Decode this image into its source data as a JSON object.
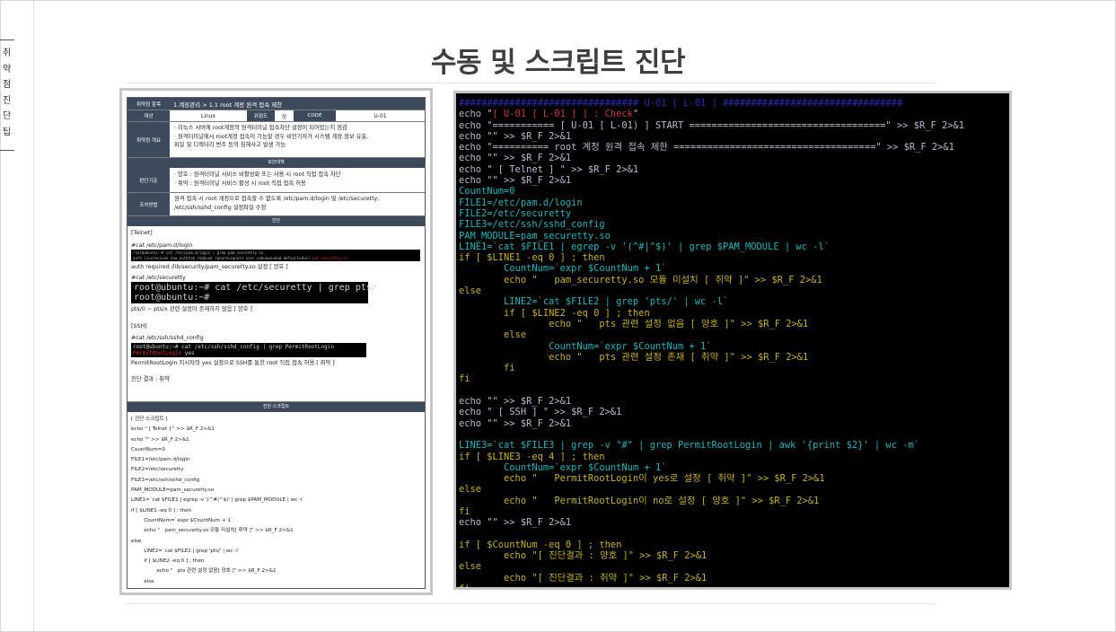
{
  "side_tab": {
    "label": "취약점진단팁"
  },
  "title": "수동 및 스크립트 진단",
  "doc": {
    "meta": {
      "item_h": "취약점 항목",
      "item_v": "1.계정관리 > 1.1 root 계정 원격 접속 제한",
      "target_h": "대상",
      "target_v": "Linux",
      "risk_h": "위험도",
      "risk_v": "상",
      "code_h": "CODE",
      "code_v": "U-01",
      "overview_h": "취약점 개요",
      "overview_1": "· 리눅스 서버에 root계정의 원격터미널 접속차단 설정이 되어있는지 점검",
      "overview_2": "· 원격터미널에서 root계정 접속이 가능할 경우 비인가자가 시스템 계정 정보 유출,",
      "overview_3": "파일 및 디렉터리 변조 등의 침해사고 발생 가능",
      "measure_band": "보안대책",
      "criteria_h": "판단기준",
      "criteria_1": "· 양호 : 원격터미널 서비스 비활성화 또는 사용 시 root 직접 접속 차단",
      "criteria_2": "· 취약 : 원격터미널 서비스 활성 시 root 직접 접속 허용",
      "action_h": "조치방법",
      "action_1": "원격 접속 시 root 계정으로 접속할 수 없도록 /etc/pam.d/login 및 /etc/securetty,",
      "action_2": "/etc/ssh/sshd_config 설정파일 수정"
    },
    "diag_band": "진단",
    "diag": {
      "telnet": "[Telnet]",
      "cmd1": "#cat /etc/pam.d/login",
      "term1_1": "root@ubuntu:~# cat /etc/pam.d/login | grep pam_securetty.so",
      "term1_2a": "auth [success=ok new_authtok_reqd=ok ignore=ignore user_unknown=bad default=die] ",
      "term1_2b": "pam_securetty.so",
      "res1": "auth required /lib/security/pam_securetty.so 설정 [ 양호 ]",
      "cmd2": "#cat /etc/securetty",
      "term2_1": "root@ubuntu:~# cat /etc/securetty | grep pts/",
      "term2_2": "root@ubuntu:~#",
      "res2": "pts/0 ~ pts/x 관련 설정이 존재하지 않음 [ 양호 ]",
      "ssh": "[SSH]",
      "cmd3": "#cat /etc/ssh/sshd_config",
      "term3_1": "root@ubuntu:~# cat /etc/ssh/sshd_config | grep PermitRootLogin",
      "term3_2a": "PermitRootLogin",
      "term3_2b": " yes",
      "res3": "PermitRootLogin 지시자의 yes 설정으로 SSH를 통한 root 직접 접속 허용 [ 취약 ]",
      "result": "진단 결과 : 취약"
    },
    "script_band": "진단 스크립트",
    "script_lines": [
      "[ 진단 스크립트 ]",
      "echo \" [ Telnet ] \" >> $R_F 2>&1",
      "echo \"\" >> $R_F 2>&1",
      "CountNum=0",
      "FILE1=/etc/pam.d/login",
      "FILE2=/etc/securetty",
      "FILE3=/etc/ssh/sshd_config",
      "PAM_MODULE=pam_securetty.so",
      "LINE1=`cat $FILE1 | egrep -v '(^#|^$)' | grep $PAM_MODULE | wc -l`",
      "if [ $LINE1 -eq 0 ] ; then",
      "        CountNum=`expr $CountNum + 1`",
      "        echo \"   pam_securetty.so 모듈 미설치[ 취약 ]\" >> $R_F 2>&1",
      "else",
      "        LINE2=`cat $FILE2 | grep 'pts/' | wc -l`",
      "        if [ $LINE2 -eq 0 ] ; then",
      "                echo \"   pts 관련 설정 없음[ 양호 ]\" >> $R_F 2>&1",
      "        else"
    ]
  },
  "terminal_lines": [
    {
      "text": "################################ U-01 [ L-01 ] ################################",
      "color": "blue"
    },
    {
      "text": "echo \"[ U-01 [ L-01 ] ] : Check\"",
      "color": "white",
      "seg": [
        "echo \"",
        "[ U-01 [ L-01 ] ] : Check",
        "\""
      ],
      "segc": [
        "white",
        "red",
        "white"
      ]
    },
    {
      "text": "echo \"=========== [ U-01 [ L-01) ] START ===================================\" >> $R_F 2>&1",
      "color": "white"
    },
    {
      "text": "echo \"\" >> $R_F 2>&1",
      "color": "white"
    },
    {
      "text": "echo \"========== root 계정 원격 접속 제한 ====================================\" >> $R_F 2>&1",
      "color": "white"
    },
    {
      "text": "echo \"\" >> $R_F 2>&1",
      "color": "white"
    },
    {
      "text": "echo \" [ Telnet ] \" >> $R_F 2>&1",
      "color": "white"
    },
    {
      "text": "echo \"\" >> $R_F 2>&1",
      "color": "white"
    },
    {
      "text": "CountNum=0",
      "color": "cyan"
    },
    {
      "text": "FILE1=/etc/pam.d/login",
      "color": "cyan"
    },
    {
      "text": "FILE2=/etc/securetty",
      "color": "cyan"
    },
    {
      "text": "FILE3=/etc/ssh/sshd_config",
      "color": "cyan"
    },
    {
      "text": "PAM_MODULE=pam_securetty.so",
      "color": "cyan"
    },
    {
      "text": "LINE1=`cat $FILE1 | egrep -v '(^#|^$)' | grep $PAM_MODULE | wc -l`",
      "color": "cyan"
    },
    {
      "text": "if [ $LINE1 -eq 0 ] ; then",
      "color": "yellow"
    },
    {
      "text": "        CountNum=`expr $CountNum + 1`",
      "color": "cyan"
    },
    {
      "text": "        echo \"   pam_securetty.so 모듈 미설치 [ 취약 ]\" >> $R_F 2>&1",
      "color": "yellow"
    },
    {
      "text": "else",
      "color": "yellow"
    },
    {
      "text": "        LINE2=`cat $FILE2 | grep 'pts/' | wc -l`",
      "color": "cyan"
    },
    {
      "text": "        if [ $LINE2 -eq 0 ] ; then",
      "color": "yellow"
    },
    {
      "text": "                echo \"   pts 관련 설정 없음 [ 양호 ]\" >> $R_F 2>&1",
      "color": "yellow"
    },
    {
      "text": "        else",
      "color": "yellow"
    },
    {
      "text": "                CountNum=`expr $CountNum + 1`",
      "color": "cyan"
    },
    {
      "text": "                echo \"   pts 관련 설정 존재 [ 취약 ]\" >> $R_F 2>&1",
      "color": "yellow"
    },
    {
      "text": "        fi",
      "color": "yellow"
    },
    {
      "text": "fi",
      "color": "yellow"
    },
    {
      "text": "",
      "color": "white"
    },
    {
      "text": "echo \"\" >> $R_F 2>&1",
      "color": "white"
    },
    {
      "text": "echo \" [ SSH ] \" >> $R_F 2>&1",
      "color": "white"
    },
    {
      "text": "echo \"\" >> $R_F 2>&1",
      "color": "white"
    },
    {
      "text": "",
      "color": "white"
    },
    {
      "text": "LINE3=`cat $FILE3 | grep -v \"#\" | grep PermitRootLogin | awk '{print $2}' | wc -m`",
      "color": "cyan"
    },
    {
      "text": "if [ $LINE3 -eq 4 ] ; then",
      "color": "yellow"
    },
    {
      "text": "        CountNum=`expr $CountNum + 1`",
      "color": "cyan"
    },
    {
      "text": "        echo \"   PermitRootLogin이 yes로 설정 [ 취약 ]\" >> $R_F 2>&1",
      "color": "yellow"
    },
    {
      "text": "else",
      "color": "yellow"
    },
    {
      "text": "        echo \"   PermitRootLogin이 no로 설정 [ 양호 ]\" >> $R_F 2>&1",
      "color": "yellow"
    },
    {
      "text": "fi",
      "color": "yellow"
    },
    {
      "text": "echo \"\" >> $R_F 2>&1",
      "color": "white"
    },
    {
      "text": "",
      "color": "white"
    },
    {
      "text": "if [ $CountNum -eq 0 ] ; then",
      "color": "yellow"
    },
    {
      "text": "        echo \"[ 진단결과 : 양호 ]\" >> $R_F 2>&1",
      "color": "yellow"
    },
    {
      "text": "else",
      "color": "yellow"
    },
    {
      "text": "        echo \"[ 진단결과 : 취약 ]\" >> $R_F 2>&1",
      "color": "yellow"
    },
    {
      "text": "fi",
      "color": "yellow"
    }
  ],
  "terminal_palette": {
    "blue": "#2b2bb8",
    "white": "#b8bcd0",
    "cyan": "#15b8c0",
    "yellow": "#c8b214",
    "red": "#c83a3a",
    "purple": "#b638b8"
  }
}
